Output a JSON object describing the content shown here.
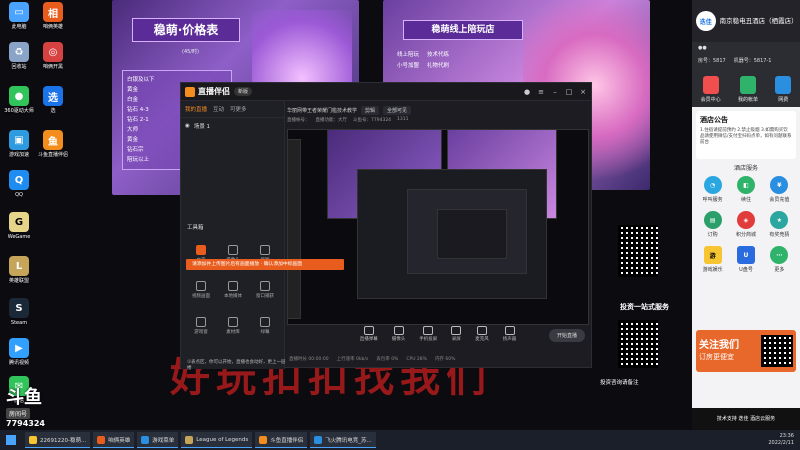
{
  "desktop_icons": [
    {
      "label": "此电脑",
      "icon": "computer-icon",
      "color": "#4aa3ff"
    },
    {
      "label": "咱俩英雄",
      "icon": "app-icon",
      "color": "#e85d1d"
    },
    {
      "label": "回收站",
      "icon": "recycle-bin-icon",
      "color": "#8aa4c8"
    },
    {
      "label": "咱俩开黑",
      "icon": "app-icon",
      "color": "#d64242"
    },
    {
      "label": "360驱动大师",
      "icon": "driver-icon",
      "color": "#31c45a"
    },
    {
      "label": "选",
      "icon": "app-icon",
      "color": "#1a73e8"
    },
    {
      "label": "游戏加速",
      "icon": "boost-icon",
      "color": "#2e9be0"
    },
    {
      "label": "斗鱼直播伴侣",
      "icon": "douyu-icon",
      "color": "#f38d1d"
    },
    {
      "label": "QQ",
      "icon": "qq-icon",
      "color": "#1e8cf0"
    },
    {
      "label": "WeGame",
      "icon": "wegame-icon",
      "color": "#e5d48a"
    },
    {
      "label": "英雄联盟",
      "icon": "lol-icon",
      "color": "#c6a45a"
    },
    {
      "label": "Steam",
      "icon": "steam-icon",
      "color": "#1b2838"
    },
    {
      "label": "腾讯视频",
      "icon": "video-icon",
      "color": "#31a0ff"
    },
    {
      "label": "微信",
      "icon": "wechat-icon",
      "color": "#31c45a"
    }
  ],
  "poster_left": {
    "title": "稳萌·价格表",
    "subtitle": "(45/时)",
    "items": [
      "白银及以下",
      "黄金",
      "白金",
      "钻石 4-3",
      "钻石 2-1",
      "大师",
      "黄金",
      "钻石宗",
      "陪玩以上"
    ]
  },
  "poster_right": {
    "title": "稳萌线上陪玩店",
    "items": [
      "线上陪玩",
      "技术代练",
      "小号加盟",
      "礼物代刷"
    ]
  },
  "marquee": "好玩扣扣找我们",
  "douyu": {
    "logo": "斗鱼",
    "sub": "房间号",
    "id": "7794324"
  },
  "window": {
    "brand": "直播伴侣",
    "badge": "新版",
    "tabs": [
      "我的直播",
      "互动",
      "可更多"
    ],
    "scene": "场景 1",
    "topbar": {
      "category": "华丽网带王者荣耀门槛技术教学",
      "field1": "剪辑",
      "field2": "全部可见"
    },
    "infobar": [
      "直播帐号：",
      "直播功能：大厅",
      "斗鱼号：7794324",
      "1311"
    ],
    "toolbox": "工具箱",
    "tools": [
      "文字",
      "摄像头",
      "截图",
      "视频画面",
      "本地媒体",
      "窗口捕获",
      "游戏窗",
      "素材库",
      "绿幕"
    ],
    "toast": "请添加并上传图片后有画面播放 · 确认添加中标画面",
    "tip": "①表点区，你可以开始，直播也会动好，更上一层楼",
    "bottom_tools": [
      "直播弹幕",
      "摄像头",
      "手机投屏",
      "录屏",
      "麦克风",
      "扬声器"
    ],
    "start_button": "开始直播",
    "status": [
      "直播时长 00:00:00",
      "上行速率 0kb/s",
      "丢包率 0%",
      "CPU 28%",
      "内存 60%"
    ]
  },
  "invest": {
    "line1": "投资一站式服务",
    "line2": "投资咨询请备注"
  },
  "right_panel": {
    "hotel": "南京稳电丑酒店（栖霞店）",
    "user_id": "房号：5817",
    "machine": "机器号：5817-1",
    "row_items": [
      "会员中心",
      "我的帐单",
      "网费"
    ],
    "notice_title": "酒店公告",
    "notice_text": "1.住宿请提前预约 2.禁止吸烟 3.如需购买饮品请使用微信/支付宝扫码点单，如有问题联系前台",
    "services_title": "酒店服务",
    "services": [
      {
        "label": "呼叫服务",
        "color": "#2aa7e0"
      },
      {
        "label": "续住",
        "color": "#2fb36b"
      },
      {
        "label": "会员充值",
        "color": "#2a8fe0"
      },
      {
        "label": "订购",
        "color": "#2a9f6a"
      },
      {
        "label": "积分商城",
        "color": "#e23b3b"
      },
      {
        "label": "有奖竞猜",
        "color": "#2aa7a0"
      },
      {
        "label": "游戏娱乐",
        "color": "#f7c531"
      },
      {
        "label": "U盘号",
        "color": "#2a6ce0"
      },
      {
        "label": "更多",
        "color": "#2fb36b"
      }
    ],
    "follow_title": "关注我们",
    "follow_sub": "订房更便宜",
    "footer": "技术支持 迭佳 酒店云服务"
  },
  "taskbar": {
    "items": [
      {
        "label": "22691220-稳萌...",
        "color": "#f7c531"
      },
      {
        "label": "咱俩英雄",
        "color": "#e85d1d"
      },
      {
        "label": "游戏菜单",
        "color": "#2a8fe0"
      },
      {
        "label": "League of Legends",
        "color": "#c6a45a"
      },
      {
        "label": "斗鱼直播伴侣",
        "color": "#f38d1d"
      },
      {
        "label": "飞火腾讯电竞_苏...",
        "color": "#2a8fe0"
      }
    ],
    "time": "23:36",
    "date": "2022/2/11"
  }
}
